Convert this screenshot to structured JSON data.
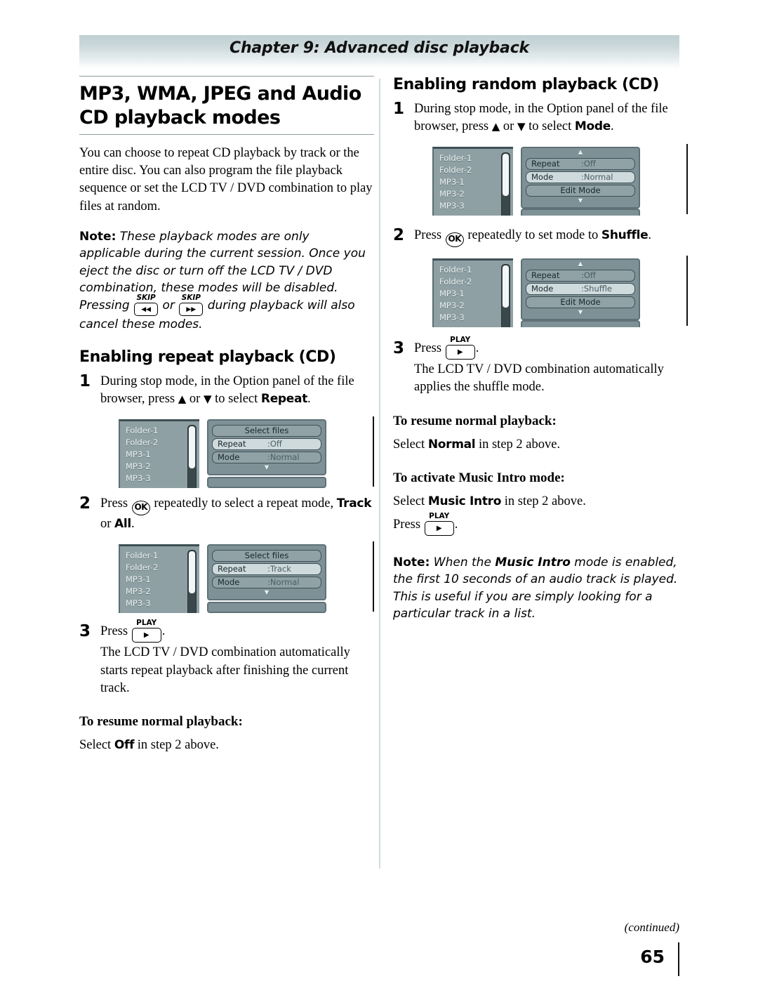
{
  "header": {
    "chapter": "Chapter 9: Advanced disc playback"
  },
  "left_column": {
    "title": "MP3, WMA, JPEG and Audio CD playback modes",
    "intro": "You can choose to repeat CD playback by track or the entire disc. You can also program the file playback sequence or set the LCD TV / DVD combination to play files at random.",
    "note_label": "Note:",
    "note_part1": "These playback modes are only applicable during the current session. Once you eject the disc or turn off the LCD TV / DVD combination, these modes will be disabled. Pressing",
    "note_or": "or",
    "note_part2": "during playback will also cancel these modes.",
    "section_heading": "Enabling repeat playback (CD)",
    "step1_num": "1",
    "step1_text_a": "During stop mode, in the Option panel of the file browser, press",
    "step1_or": "or",
    "step1_text_b": "to select",
    "step1_target": "Repeat",
    "step1_period": ".",
    "step2_num": "2",
    "step2_text_a": "Press",
    "step2_text_b": "repeatedly to select a repeat mode,",
    "step2_target_1": "Track",
    "step2_or": "or",
    "step2_target_2": "All",
    "step2_period": ".",
    "step3_num": "3",
    "step3_press": "Press",
    "step3_period": ".",
    "step3_text": "The LCD TV / DVD combination automatically starts repeat playback after finishing the current track.",
    "resume_heading": "To resume normal playback:",
    "resume_text_a": "Select",
    "resume_target": "Off",
    "resume_text_b": "in step 2 above."
  },
  "right_column": {
    "section_heading": "Enabling random playback (CD)",
    "step1_num": "1",
    "step1_text_a": "During stop mode, in the Option panel of the file browser, press",
    "step1_or": "or",
    "step1_text_b": "to select",
    "step1_target": "Mode",
    "step1_period": ".",
    "step2_num": "2",
    "step2_text_a": "Press",
    "step2_text_b": "repeatedly to set mode to",
    "step2_target": "Shuffle",
    "step2_period": ".",
    "step3_num": "3",
    "step3_press": "Press",
    "step3_period": ".",
    "step3_text": "The LCD TV / DVD combination automatically applies the shuffle mode.",
    "resume_heading": "To resume normal playback:",
    "resume_text_a": "Select",
    "resume_target": "Normal",
    "resume_text_b": "in step 2 above.",
    "intro_heading": "To activate Music Intro mode:",
    "intro_text_a": "Select",
    "intro_target": "Music Intro",
    "intro_text_b": "in step 2 above.",
    "intro_press": "Press",
    "intro_press_period": ".",
    "note_label": "Note:",
    "note_part1": "When the",
    "note_bold": "Music Intro",
    "note_part2": "mode is enabled, the first 10 seconds of an audio track is played. This is useful if you are simply looking for a particular track in a list."
  },
  "buttons": {
    "skip_caption": "SKIP",
    "skip_prev_glyph": "◀◀",
    "skip_next_glyph": "▶▶",
    "play_caption": "PLAY",
    "play_glyph": "▶",
    "ok_label": "OK",
    "arrow_up": "▲",
    "arrow_down": "▼"
  },
  "screens": {
    "file_list": [
      "Folder-1",
      "Folder-2",
      "MP3-1",
      "MP3-2",
      "MP3-3"
    ],
    "left_1": {
      "select_files": "Select files",
      "repeat_label": "Repeat",
      "repeat_value": ":Off",
      "mode_label": "Mode",
      "mode_value": ":Normal",
      "down_arrow": "▼"
    },
    "left_2": {
      "select_files": "Select files",
      "repeat_label": "Repeat",
      "repeat_value": ":Track",
      "mode_label": "Mode",
      "mode_value": ":Normal",
      "down_arrow": "▼"
    },
    "right_1": {
      "up_arrow": "▲",
      "repeat_label": "Repeat",
      "repeat_value": ":Off",
      "mode_label": "Mode",
      "mode_value": ":Normal",
      "edit_mode": "Edit  Mode",
      "down_arrow": "▼"
    },
    "right_2": {
      "up_arrow": "▲",
      "repeat_label": "Repeat",
      "repeat_value": ":Off",
      "mode_label": "Mode",
      "mode_value": ":Shuffle",
      "edit_mode": "Edit  Mode",
      "down_arrow": "▼"
    }
  },
  "footer": {
    "continued": "(continued)",
    "page_number": "65"
  },
  "colors": {
    "screen_bg": "#8fa0a4",
    "panel_bg": "#7e9196",
    "highlight": "#cfdadd",
    "header_gradient_top": "#bfcfd2"
  }
}
